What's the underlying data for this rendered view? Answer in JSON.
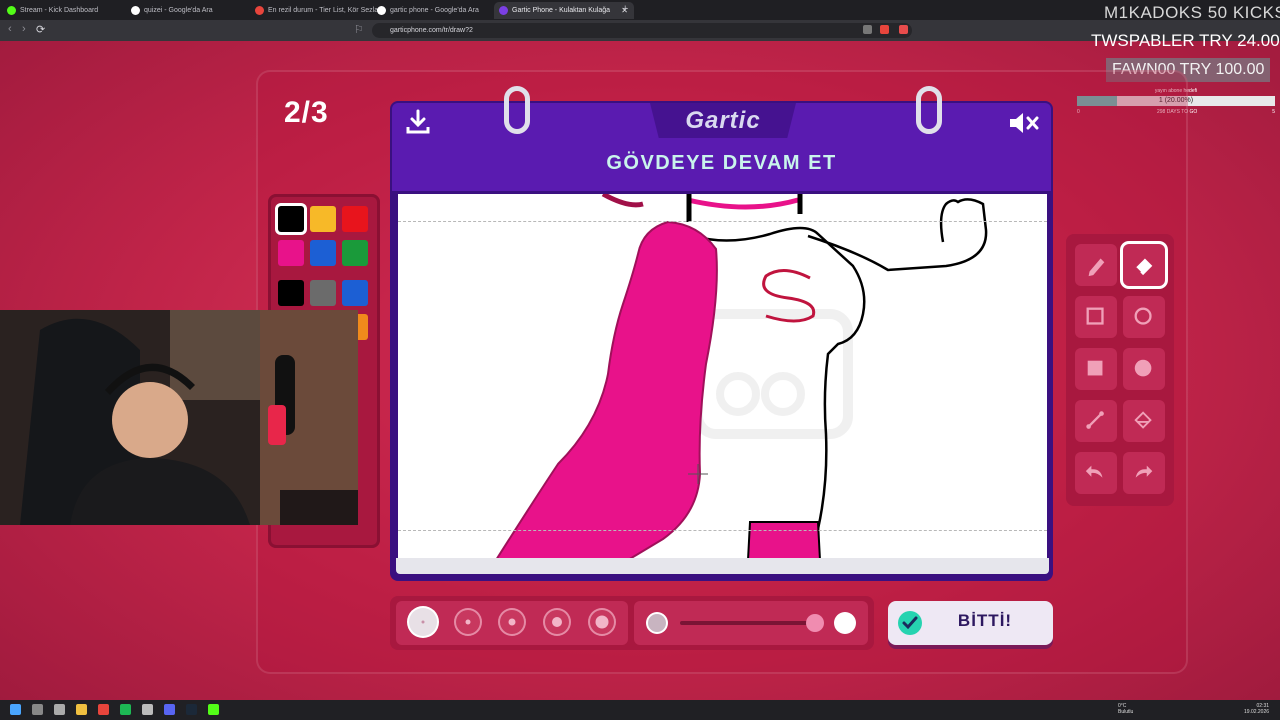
{
  "browser": {
    "tabs": [
      {
        "label": "Stream - Kick Dashboard",
        "favicon_color": "#53fc18"
      },
      {
        "label": "quizei - Google'da Ara",
        "favicon_color": "#ffffff"
      },
      {
        "label": "En rezil durum - Tier List, Kör Sezlar",
        "favicon_color": "#e8453c"
      },
      {
        "label": "gartic phone - Google'da Ara",
        "favicon_color": "#ffffff"
      },
      {
        "label": "Gartic Phone - Kulaktan Kulağa",
        "favicon_color": "#7b3fe4",
        "active": true
      }
    ],
    "new_tab": "+",
    "url": "garticphone.com/tr/draw?2"
  },
  "overlay": {
    "kicks": "M1KADOKS  50 KICKS",
    "tip1": "TWSPABLER  TRY 24.00",
    "tip2": "FAWN00  TRY 100.00",
    "goal_title": "yayın abone hedefi",
    "goal_value": "1 (20.00%)",
    "goal_progress": 0.2,
    "goal_min": "0",
    "goal_max": "5",
    "goal_days": "298 DAYS TO GO"
  },
  "game": {
    "round": "2/3",
    "logo": "Gartic",
    "instruction": "GÖVDEYE DEVAM ET",
    "done_label": "BİTTİ!",
    "palette": [
      "#000000",
      "#f7b928",
      "#e8141c",
      "#e8128a",
      "#1c5fd4",
      "#1a9a3a",
      "#000000",
      "#6b6b6b",
      "#1c5fd4",
      "#2aa8f0",
      "#c03a10",
      "#f08a1c",
      "#e84c4c",
      "#f5a8a0"
    ],
    "selected_color_index": 0,
    "tools": [
      "pencil-tool",
      "eraser-tool",
      "rectangle-tool",
      "ellipse-tool",
      "filled-rectangle-tool",
      "filled-ellipse-tool",
      "line-tool",
      "fill-tool",
      "undo-tool",
      "redo-tool"
    ],
    "selected_tool": "eraser-tool",
    "brush_sizes": 5,
    "selected_size_index": 0,
    "drawing_color": "#e8128a"
  },
  "taskbar": {
    "weather_temp": "0°C",
    "weather_desc": "Bulutlu",
    "time": "02:31",
    "date": "19.02.2026"
  }
}
